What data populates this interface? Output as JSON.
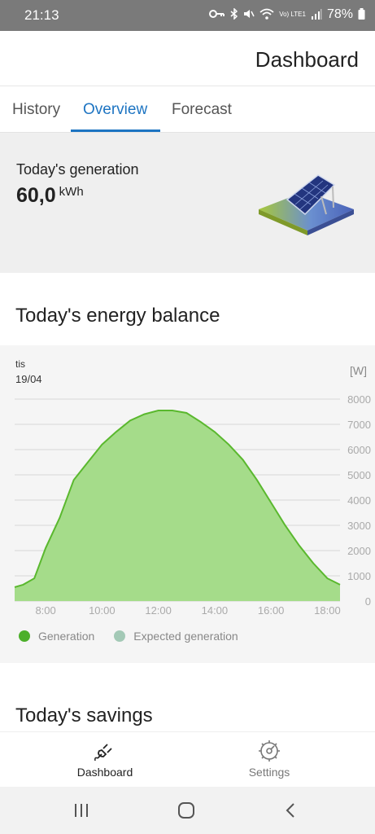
{
  "status_bar": {
    "time": "21:13",
    "network": "Vo) LTE1",
    "battery": "78%",
    "icons": [
      "key-icon",
      "bluetooth-icon",
      "mute-icon",
      "wifi-icon",
      "signal-icon",
      "battery-icon"
    ]
  },
  "header": {
    "title": "Dashboard"
  },
  "tabs": [
    {
      "label": "History",
      "active": false
    },
    {
      "label": "Overview",
      "active": true
    },
    {
      "label": "Forecast",
      "active": false
    }
  ],
  "generation_card": {
    "label": "Today's generation",
    "value": "60,0",
    "unit": "kWh",
    "icon": "solar-panel-icon"
  },
  "energy_balance": {
    "title": "Today's energy balance",
    "day": "tis",
    "date": "19/04",
    "unit": "[W]"
  },
  "chart_data": {
    "type": "area",
    "ylabel": "[W]",
    "ylim": [
      0,
      8000
    ],
    "yticks": [
      "8000",
      "7000",
      "6000",
      "5000",
      "4000",
      "3000",
      "2000",
      "1000",
      "0"
    ],
    "xticks": [
      "8:00",
      "10:00",
      "12:00",
      "14:00",
      "16:00",
      "18:00"
    ],
    "xlim": [
      6.9,
      18.45
    ],
    "grid": true,
    "legend_position": "bottom-left",
    "series": [
      {
        "name": "Generation",
        "color": "#5ab82e",
        "fill": "#a5dc8a",
        "x": [
          6.9,
          7.2,
          7.6,
          8.0,
          8.5,
          9.0,
          9.5,
          10.0,
          10.5,
          11.0,
          11.5,
          12.0,
          12.5,
          13.0,
          13.5,
          14.0,
          14.5,
          15.0,
          15.5,
          16.0,
          16.5,
          17.0,
          17.5,
          18.0,
          18.45
        ],
        "values": [
          550,
          650,
          900,
          2100,
          3300,
          4800,
          5500,
          6200,
          6700,
          7150,
          7400,
          7550,
          7550,
          7450,
          7100,
          6700,
          6200,
          5600,
          4800,
          3900,
          3000,
          2200,
          1500,
          900,
          650
        ]
      }
    ],
    "legend": [
      {
        "name": "Generation",
        "color": "#4caf2a"
      },
      {
        "name": "Expected generation",
        "color": "#a3c9b6"
      }
    ]
  },
  "savings": {
    "title": "Today's savings"
  },
  "bottom_nav": [
    {
      "label": "Dashboard",
      "icon": "plug-icon",
      "active": true
    },
    {
      "label": "Settings",
      "icon": "settings-icon",
      "active": false
    }
  ],
  "system_nav": [
    "recent-apps-icon",
    "home-icon",
    "back-icon"
  ]
}
